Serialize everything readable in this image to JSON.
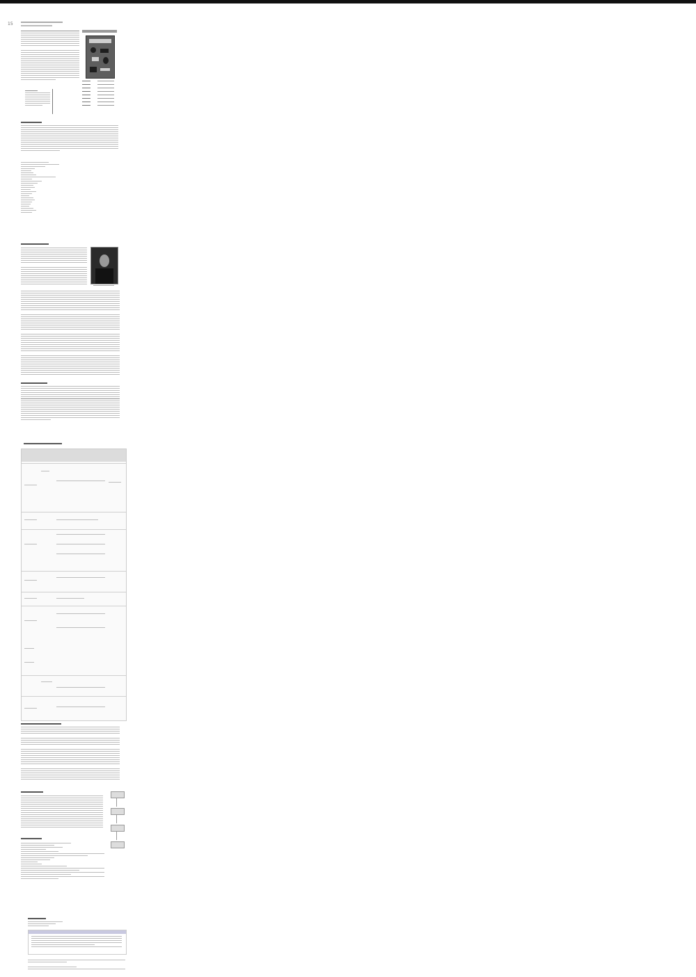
{
  "page": {
    "number": "15"
  },
  "icons": {
    "book_cover": "book-cover-illustration",
    "portrait": "portrait-photo"
  },
  "colors": {
    "paper": "#ffffff",
    "top_edge": "#111111",
    "ink_dark": "#555555",
    "ink_light": "#bbbbbb"
  }
}
